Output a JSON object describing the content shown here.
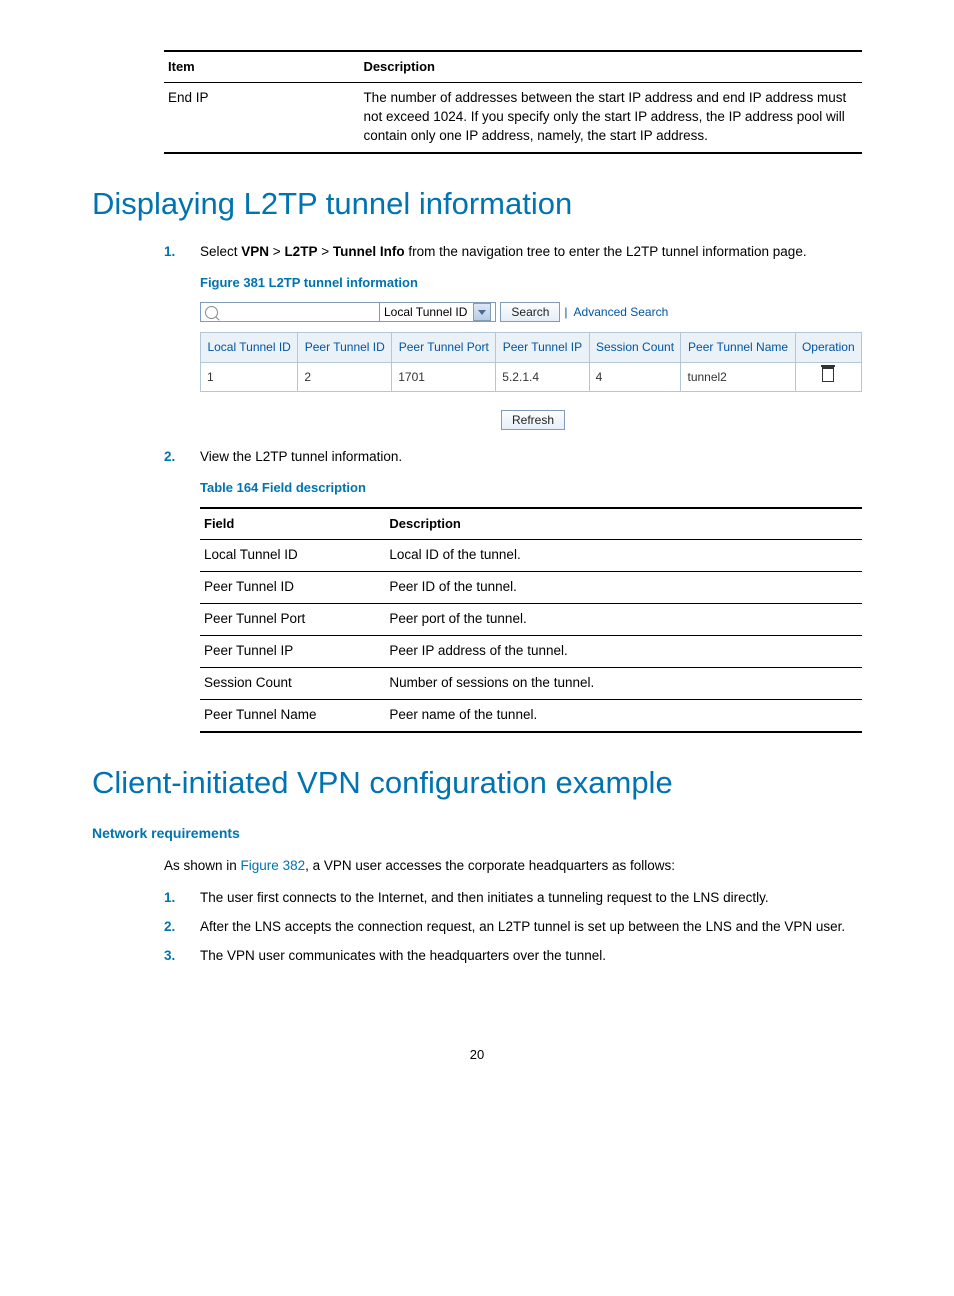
{
  "top_table": {
    "headers": [
      "Item",
      "Description"
    ],
    "rows": [
      {
        "item": "End IP",
        "desc": "The number of addresses between the start IP address and end IP address must not exceed 1024. If you specify only the start IP address, the IP address pool will contain only one IP address, namely, the start IP address."
      }
    ]
  },
  "h1_a": "Displaying L2TP tunnel information",
  "step1": {
    "prefix": "Select ",
    "b1": "VPN",
    "sep": " > ",
    "b2": "L2TP",
    "b3": "Tunnel Info",
    "suffix": " from the navigation tree to enter the L2TP tunnel information page."
  },
  "fig_caption": "Figure 381 L2TP tunnel information",
  "figure": {
    "select_label": "Local Tunnel ID",
    "search_btn": "Search",
    "adv": "Advanced Search",
    "headers": [
      "Local Tunnel ID",
      "Peer Tunnel ID",
      "Peer Tunnel Port",
      "Peer Tunnel IP",
      "Session Count",
      "Peer Tunnel Name",
      "Operation"
    ],
    "row": [
      "1",
      "2",
      "1701",
      "5.2.1.4",
      "4",
      "tunnel2"
    ],
    "refresh": "Refresh"
  },
  "step2": "View the L2TP tunnel information.",
  "table_caption": "Table 164 Field description",
  "field_table": {
    "headers": [
      "Field",
      "Description"
    ],
    "rows": [
      [
        "Local Tunnel ID",
        "Local ID of the tunnel."
      ],
      [
        "Peer Tunnel ID",
        "Peer ID of the tunnel."
      ],
      [
        "Peer Tunnel Port",
        "Peer port of the tunnel."
      ],
      [
        "Peer Tunnel IP",
        "Peer IP address of the tunnel."
      ],
      [
        "Session Count",
        "Number of sessions on the tunnel."
      ],
      [
        "Peer Tunnel Name",
        "Peer name of the tunnel."
      ]
    ]
  },
  "h1_b": "Client-initiated VPN configuration example",
  "h2_b": "Network requirements",
  "intro_b": {
    "prefix": "As shown in ",
    "link": "Figure 382",
    "suffix": ", a VPN user accesses the corporate headquarters as follows:"
  },
  "steps_b": [
    "The user first connects to the Internet, and then initiates a tunneling request to the LNS directly.",
    "After the LNS accepts the connection request, an L2TP tunnel is set up between the LNS and the VPN user.",
    "The VPN user communicates with the headquarters over the tunnel."
  ],
  "page_number": "20",
  "numbers": {
    "n1": "1.",
    "n2": "2.",
    "n3": "3."
  }
}
